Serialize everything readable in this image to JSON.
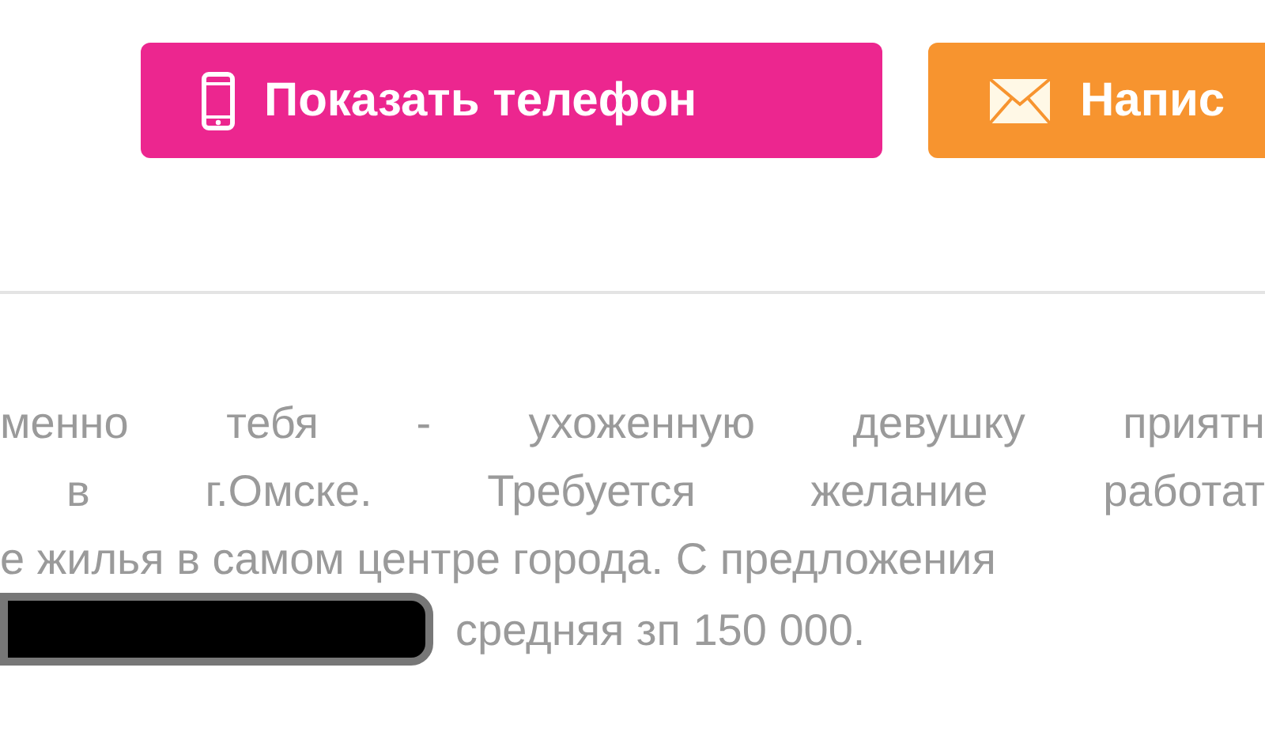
{
  "buttons": [
    {
      "label": "Показать телефон",
      "kind": "phone",
      "color": "#ec268f"
    },
    {
      "label": "Напис",
      "kind": "mail",
      "color": "#f7942f"
    }
  ],
  "description": {
    "lines": [
      {
        "text": "менно тебя - ухоженную девушку приятн",
        "justified": true
      },
      {
        "text": "в г.Омске. Требуется желание работат",
        "justified": true
      },
      {
        "text": "е жилья в самом центре города. С предложения",
        "justified": false
      },
      {
        "text": "средняя зп 150 000.",
        "justified": false,
        "redacted": true
      }
    ]
  }
}
